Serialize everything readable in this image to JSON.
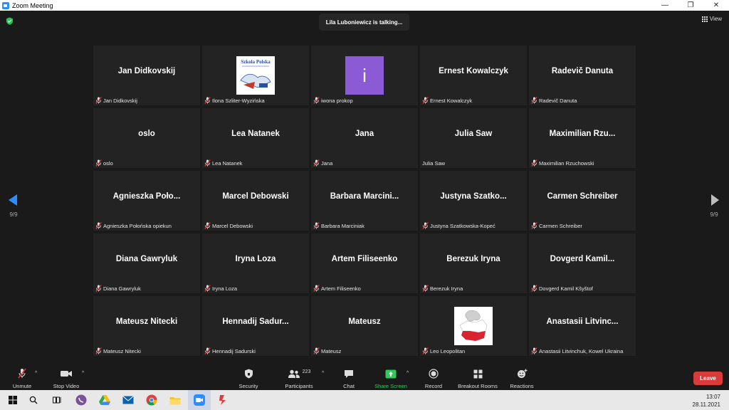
{
  "window": {
    "title": "Zoom Meeting"
  },
  "status": {
    "talking": "Lila Luboniewicz is talking..."
  },
  "view": {
    "label": "View"
  },
  "pager": {
    "left": "9/9",
    "right": "9/9"
  },
  "colors": {
    "accent": "#2d8cff",
    "leave": "#d93a3a",
    "share": "#34c759",
    "muted": "#e03b3b"
  },
  "tiles": [
    {
      "big": "Jan Didkovskij",
      "label": "Jan Didkovskij",
      "muted": true
    },
    {
      "big": "",
      "label": "Ilona Szliter-Wyzińska",
      "muted": true,
      "image": "szkola-polska-logo",
      "logo_text": "Szkoła Polska"
    },
    {
      "big": "",
      "label": "iwona prokop",
      "muted": true,
      "avatar": "i"
    },
    {
      "big": "Ernest Kowalczyk",
      "label": "Ernest Kowalczyk",
      "muted": true
    },
    {
      "big": "Radevič Danuta",
      "label": "Radevič Danuta",
      "muted": true
    },
    {
      "big": "oslo",
      "label": "oslo",
      "muted": true
    },
    {
      "big": "Lea Natanek",
      "label": "Lea Natanek",
      "muted": true
    },
    {
      "big": "Jana",
      "label": "Jana",
      "muted": true
    },
    {
      "big": "Julia Saw",
      "label": "Julia Saw",
      "muted": false
    },
    {
      "big": "Maximilian  Rzu...",
      "label": "Maximilian Rzuchowski",
      "muted": true
    },
    {
      "big": "Agnieszka  Poło...",
      "label": "Agnieszka Połońska opiekun",
      "muted": true
    },
    {
      "big": "Marcel Debowski",
      "label": "Marcel Debowski",
      "muted": true
    },
    {
      "big": "Barbara  Marcini...",
      "label": "Barbara Marciniak",
      "muted": true
    },
    {
      "big": "Justyna  Szatko...",
      "label": "Justyna Szatkowska-Kopeć",
      "muted": true
    },
    {
      "big": "Carmen Schreiber",
      "label": "Carmen Schreiber",
      "muted": true
    },
    {
      "big": "Diana Gawryluk",
      "label": "Diana Gawryluk",
      "muted": true
    },
    {
      "big": "Iryna Loza",
      "label": "Iryna Loza",
      "muted": true
    },
    {
      "big": "Artem Filiseenko",
      "label": "Artem Filiseenko",
      "muted": true
    },
    {
      "big": "Berezuk Iryna",
      "label": "Berezuk Iryna",
      "muted": true
    },
    {
      "big": "Dovgerd  Kamil...",
      "label": "Dovgerd Kamil Kšyštof",
      "muted": true
    },
    {
      "big": "Mateusz Nitecki",
      "label": "Mateusz Nitecki",
      "muted": true
    },
    {
      "big": "Hennadij  Sadur...",
      "label": "Hennadij Sadurski",
      "muted": true
    },
    {
      "big": "Mateusz",
      "label": "Mateusz",
      "muted": true
    },
    {
      "big": "",
      "label": "Leo Leopolitan",
      "muted": true,
      "image": "poland-map-eagle"
    },
    {
      "big": "Anastasii  Litvinc...",
      "label": "Anastasii Litvinchuk, Kowel Ukraina",
      "muted": true
    }
  ],
  "toolbar": {
    "unmute": "Unmute",
    "stop_video": "Stop Video",
    "security": "Security",
    "participants": "Participants",
    "participants_count": "223",
    "chat": "Chat",
    "share_screen": "Share Screen",
    "record": "Record",
    "breakout": "Breakout Rooms",
    "reactions": "Reactions",
    "leave": "Leave"
  },
  "taskbar": {
    "time": "13:07",
    "date": "28.11.2021",
    "apps": [
      "windows-start-icon",
      "search-icon",
      "task-view-icon",
      "viber-icon",
      "google-drive-icon",
      "mail-icon",
      "chrome-icon",
      "file-explorer-icon",
      "zoom-icon",
      "app-icon"
    ]
  }
}
